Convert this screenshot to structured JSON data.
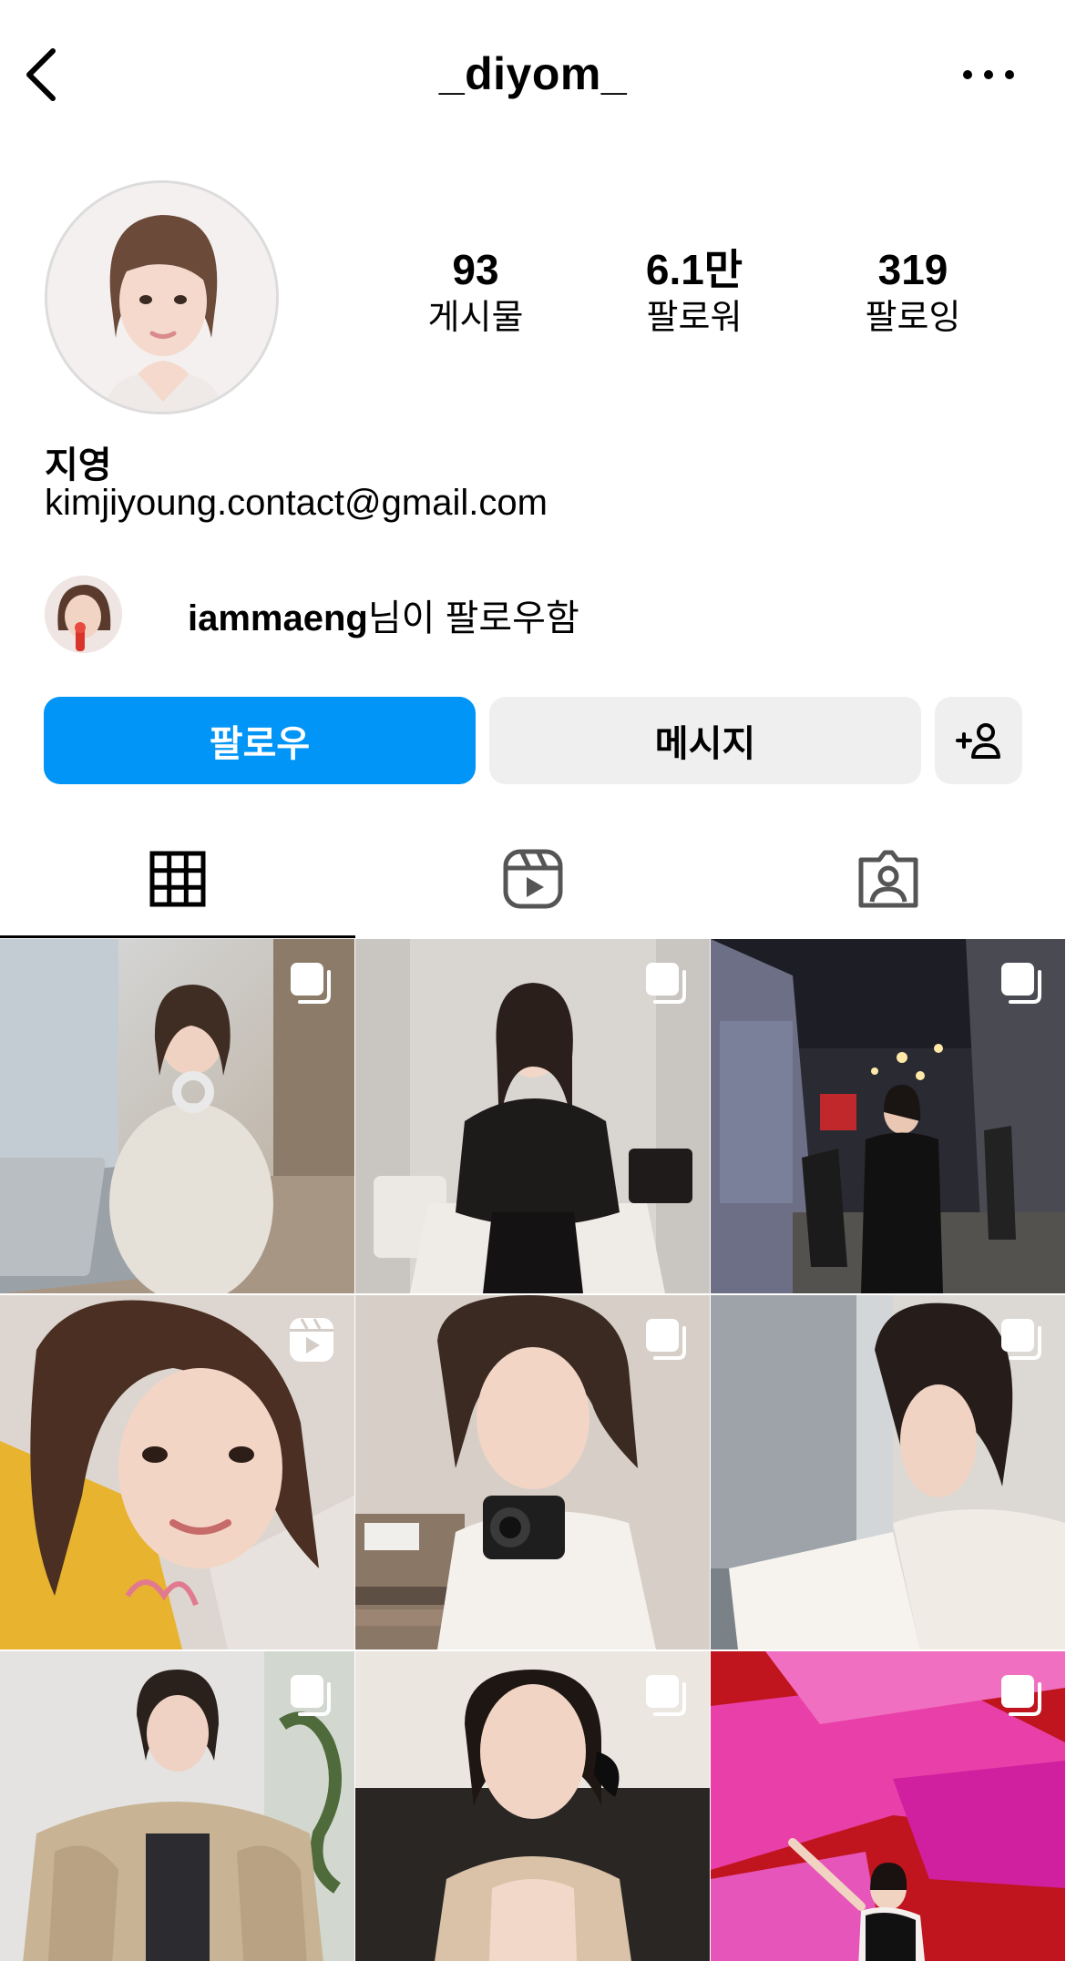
{
  "header": {
    "username": "_diyom_"
  },
  "profile": {
    "stats": {
      "posts_value": "93",
      "posts_label": "게시물",
      "followers_value": "6.1만",
      "followers_label": "팔로워",
      "following_value": "319",
      "following_label": "팔로잉"
    },
    "display_name": "지영",
    "bio": "kimjiyoung.contact@gmail.com",
    "followed_by": {
      "username": "iammaeng",
      "suffix": "님이 팔로우함"
    }
  },
  "actions": {
    "follow_label": "팔로우",
    "message_label": "메시지",
    "suggest_icon": "add-person-icon"
  },
  "tabs": [
    {
      "name": "posts-grid",
      "icon": "grid-icon",
      "active": true
    },
    {
      "name": "reels",
      "icon": "reels-icon",
      "active": false
    },
    {
      "name": "tagged",
      "icon": "tagged-person-icon",
      "active": false
    }
  ],
  "posts": [
    {
      "badge": "carousel-icon"
    },
    {
      "badge": "carousel-icon"
    },
    {
      "badge": "carousel-icon"
    },
    {
      "badge": "reels-icon"
    },
    {
      "badge": "carousel-icon"
    },
    {
      "badge": "carousel-icon"
    },
    {
      "badge": "carousel-icon"
    },
    {
      "badge": "carousel-icon"
    },
    {
      "badge": "carousel-icon"
    }
  ],
  "colors": {
    "follow_button": "#0095f6",
    "secondary_button": "#efefef",
    "text": "#000000"
  }
}
